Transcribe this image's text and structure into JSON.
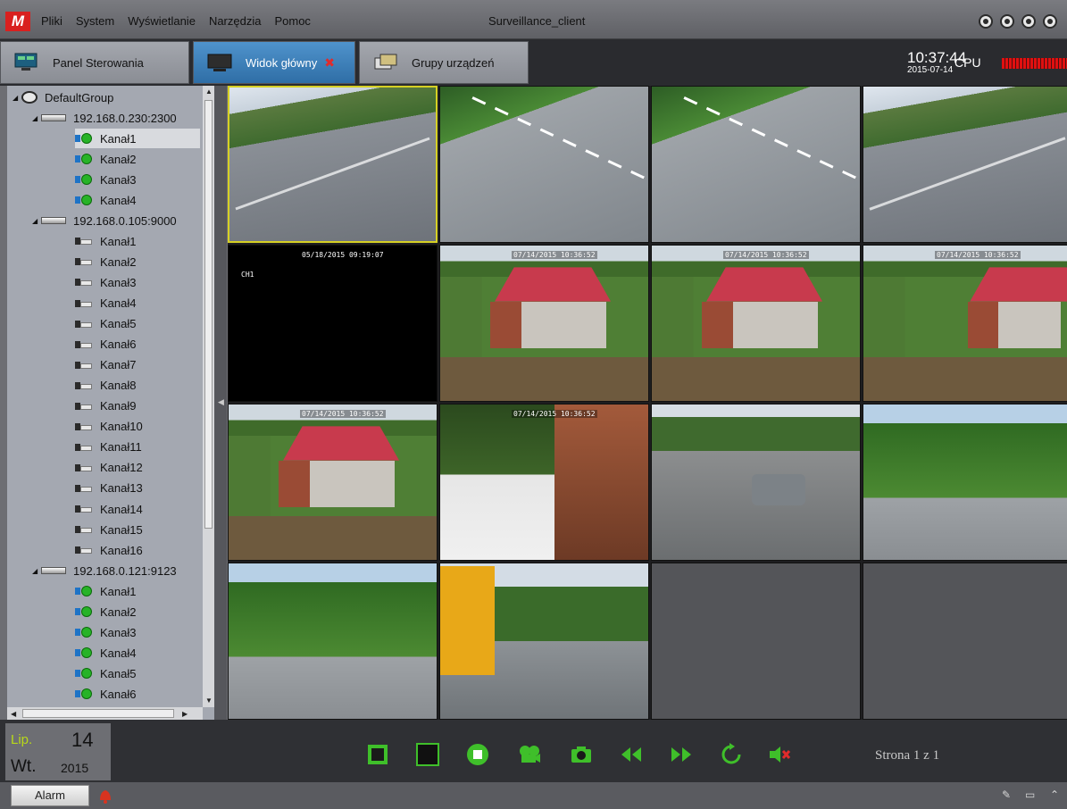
{
  "titlebar": {
    "menu": [
      "Pliki",
      "System",
      "Wyświetlanie",
      "Narzędzia",
      "Pomoc"
    ],
    "app_title": "Surveillance_client"
  },
  "tabs": [
    {
      "label": "Panel Sterowania",
      "icon": "monitor-panel-icon"
    },
    {
      "label": "Widok główny",
      "icon": "monitor-icon"
    },
    {
      "label": "Grupy urządzeń",
      "icon": "device-group-icon"
    }
  ],
  "status": {
    "time": "10:37:44",
    "date": "2015-07-14",
    "cpu_label": "CPU",
    "cpu_color": "#e01010"
  },
  "tree": {
    "root": "DefaultGroup",
    "devices": [
      {
        "name": "192.168.0.230:2300",
        "channels": [
          "Kanał1",
          "Kanał2",
          "Kanał3",
          "Kanał4"
        ],
        "online": true
      },
      {
        "name": "192.168.0.105:9000",
        "channels": [
          "Kanał1",
          "Kanał2",
          "Kanał3",
          "Kanał4",
          "Kanał5",
          "Kanał6",
          "Kanał7",
          "Kanał8",
          "Kanał9",
          "Kanał10",
          "Kanał11",
          "Kanał12",
          "Kanał13",
          "Kanał14",
          "Kanał15",
          "Kanał16"
        ],
        "online": false
      },
      {
        "name": "192.168.0.121:9123",
        "channels": [
          "Kanał1",
          "Kanał2",
          "Kanał3",
          "Kanał4",
          "Kanał5",
          "Kanał6"
        ],
        "online": true
      }
    ],
    "selected_channel": "Kanał1"
  },
  "grid": {
    "osd": {
      "cell5": "05/18/2015 09:19:07",
      "cell5_ch": "CH1",
      "cell6": "07/14/2015 10:36:52",
      "cell7": "07/14/2015 10:36:52",
      "cell8": "07/14/2015 10:36:52",
      "cell9": "07/14/2015 10:36:52",
      "cell10": "07/14/2015 10:36:52"
    }
  },
  "bottom": {
    "month": "Lip.",
    "day": "14",
    "weekday": "Wt.",
    "year": "2015",
    "pager": "Strona 1 z 1",
    "controls": [
      "fullscreen-icon",
      "single-view-icon",
      "stop-icon",
      "record-icon",
      "snapshot-icon",
      "rewind-icon",
      "forward-icon",
      "refresh-icon",
      "mute-icon"
    ],
    "accent": "#3fbf2a"
  },
  "statusbar": {
    "alarm_label": "Alarm"
  }
}
